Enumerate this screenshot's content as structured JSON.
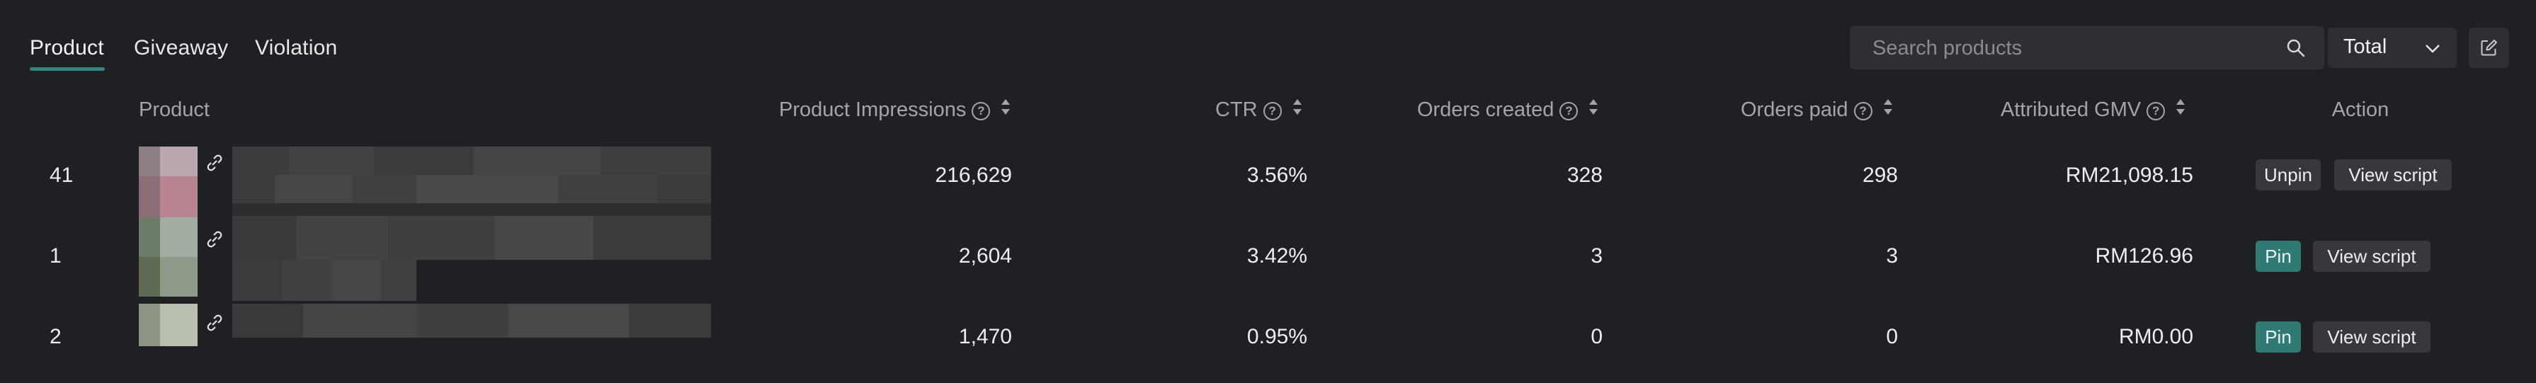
{
  "tabs": [
    {
      "label": "Product",
      "active": true
    },
    {
      "label": "Giveaway",
      "active": false
    },
    {
      "label": "Violation",
      "active": false
    }
  ],
  "search": {
    "placeholder": "Search products"
  },
  "filter": {
    "selected": "Total"
  },
  "columns": {
    "product": "Product",
    "impressions": "Product Impressions",
    "ctr": "CTR",
    "orders_created": "Orders created",
    "orders_paid": "Orders paid",
    "gmv": "Attributed GMV",
    "action": "Action"
  },
  "rows": [
    {
      "rank": "41",
      "impressions": "216,629",
      "ctr": "3.56%",
      "orders_created": "328",
      "orders_paid": "298",
      "gmv": "RM21,098.15",
      "primary_action": "Unpin",
      "secondary_action": "View script"
    },
    {
      "rank": "1",
      "impressions": "2,604",
      "ctr": "3.42%",
      "orders_created": "3",
      "orders_paid": "3",
      "gmv": "RM126.96",
      "primary_action": "Pin",
      "secondary_action": "View script"
    },
    {
      "rank": "2",
      "impressions": "1,470",
      "ctr": "0.95%",
      "orders_created": "0",
      "orders_paid": "0",
      "gmv": "RM0.00",
      "primary_action": "Pin",
      "secondary_action": "View script"
    }
  ],
  "colors": {
    "accent": "#37837d",
    "background": "#1f2023",
    "pin_button": "#2f7a73"
  }
}
